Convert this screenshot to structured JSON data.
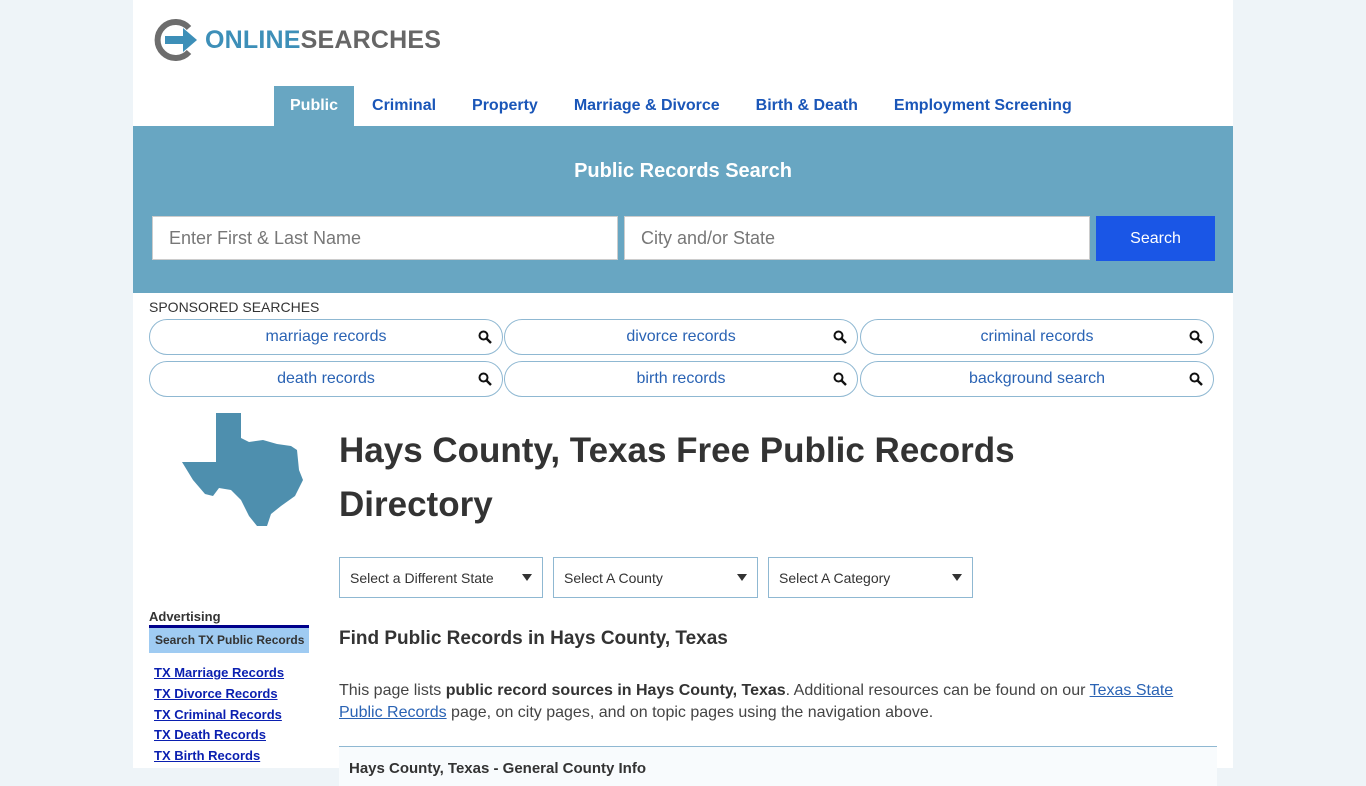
{
  "logo": {
    "online": "ONLINE",
    "searches": "SEARCHES"
  },
  "nav": [
    "Public",
    "Criminal",
    "Property",
    "Marriage & Divorce",
    "Birth & Death",
    "Employment Screening"
  ],
  "banner": {
    "title": "Public Records Search",
    "name_placeholder": "Enter First & Last Name",
    "city_placeholder": "City and/or State",
    "search_label": "Search"
  },
  "sponsored": {
    "label": "SPONSORED SEARCHES",
    "items": [
      "marriage records",
      "divorce records",
      "criminal records",
      "death records",
      "birth records",
      "background search"
    ]
  },
  "main": {
    "title": "Hays County, Texas Free Public Records Directory",
    "selects": [
      "Select a Different State",
      "Select A County",
      "Select A Category"
    ],
    "subtitle": "Find Public Records in Hays County, Texas",
    "para": {
      "p1": "This page lists ",
      "b1": "public record sources in Hays County, Texas",
      "p2": ". Additional resources can be found on our ",
      "link": "Texas State Public Records",
      "p3": " page, on city pages, and on topic pages using the navigation above."
    },
    "info_title": "Hays County, Texas - General County Info"
  },
  "sidebar": {
    "advertising": "Advertising",
    "heading": "Search TX Public Records",
    "links": [
      "TX Marriage Records",
      "TX Divorce Records",
      "TX Criminal Records",
      "TX Death Records",
      "TX Birth Records"
    ]
  },
  "colors": {
    "banner": "#68a6c2",
    "search_button": "#1a56e6",
    "nav_link": "#1a56b8",
    "map": "#4e8fae"
  }
}
